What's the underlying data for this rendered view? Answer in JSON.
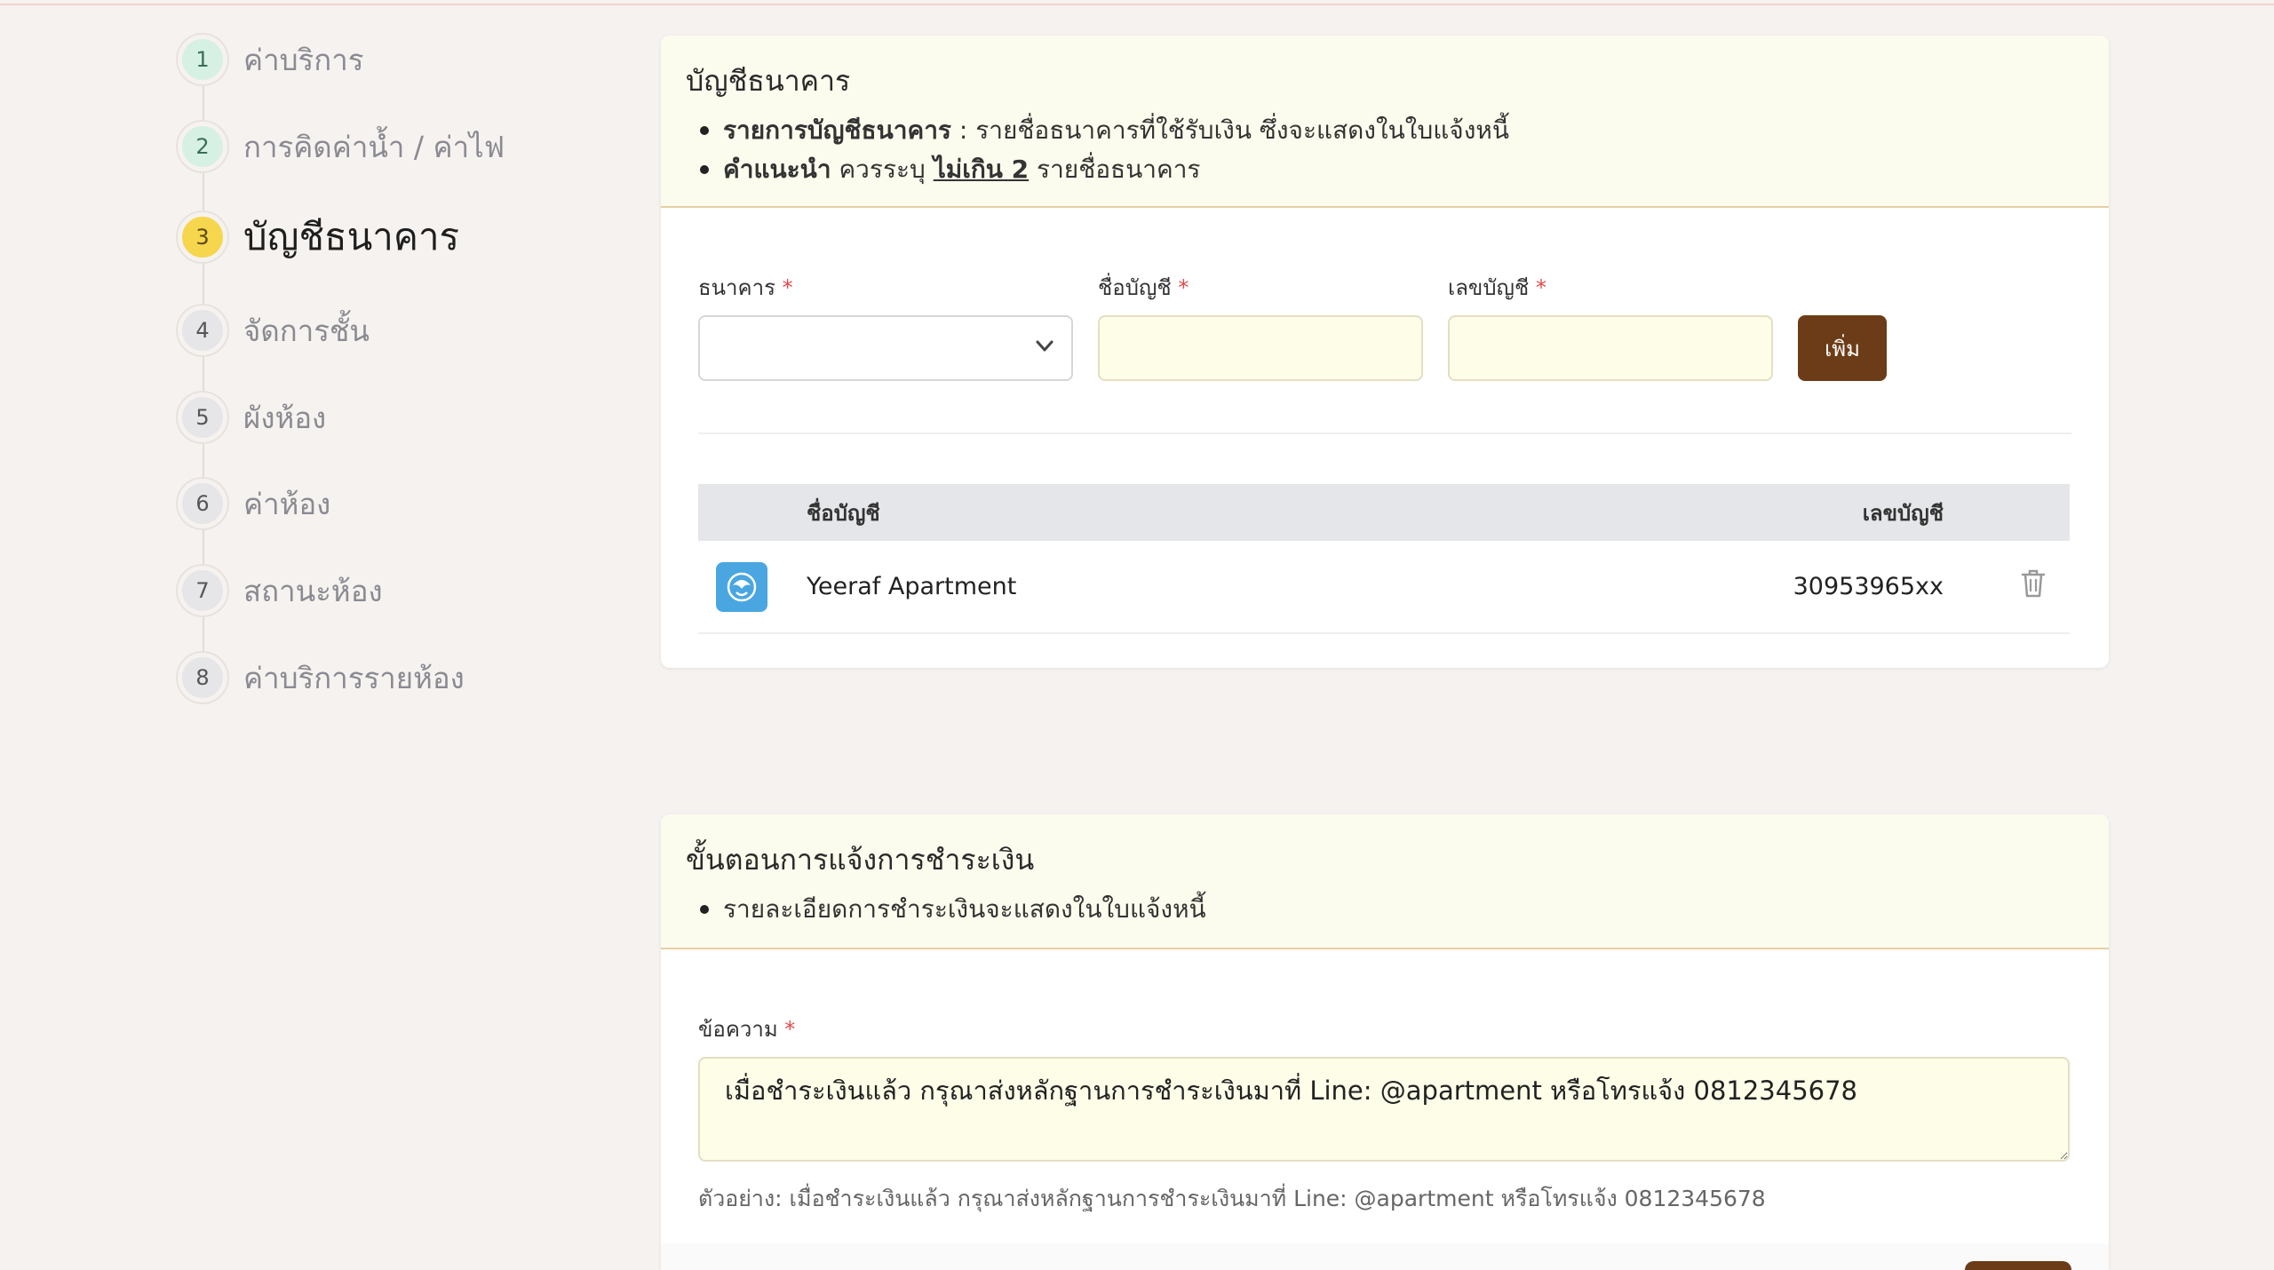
{
  "stepper": {
    "steps": [
      {
        "num": "1",
        "label": "ค่าบริการ",
        "state": "done"
      },
      {
        "num": "2",
        "label": "การคิดค่าน้ำ / ค่าไฟ",
        "state": "done"
      },
      {
        "num": "3",
        "label": "บัญชีธนาคาร",
        "state": "active"
      },
      {
        "num": "4",
        "label": "จัดการชั้น",
        "state": "todo"
      },
      {
        "num": "5",
        "label": "ผังห้อง",
        "state": "todo"
      },
      {
        "num": "6",
        "label": "ค่าห้อง",
        "state": "todo"
      },
      {
        "num": "7",
        "label": "สถานะห้อง",
        "state": "todo"
      },
      {
        "num": "8",
        "label": "ค่าบริการรายห้อง",
        "state": "todo"
      }
    ]
  },
  "bank": {
    "title": "บัญชีธนาคาร",
    "note1_bold": "รายการบัญชีธนาคาร",
    "note1_rest": " : รายชื่อธนาคารที่ใช้รับเงิน ซึ่งจะแสดงในใบแจ้งหนี้",
    "note2_bold": "คำแนะนำ",
    "note2_mid": " ควรระบุ ",
    "note2_underline": "ไม่เกิน 2",
    "note2_end": " รายชื่อธนาคาร",
    "form": {
      "bank_label": "ธนาคาร",
      "account_name_label": "ชื่อบัญชี",
      "account_number_label": "เลขบัญชี",
      "required_mark": "*",
      "add_label": "เพิ่ม",
      "bank_value": "",
      "account_name_value": "",
      "account_number_value": ""
    },
    "table": {
      "col_name": "ชื่อบัญชี",
      "col_number": "เลขบัญชี",
      "rows": [
        {
          "name": "Yeeraf Apartment",
          "number": "30953965xx",
          "logo": "kasikorn-logo-icon",
          "logo_color": "#4aa6e0"
        }
      ]
    }
  },
  "payment": {
    "title": "ขั้นตอนการแจ้งการชำระเงิน",
    "note1": "รายละเอียดการชำระเงินจะแสดงในใบแจ้งหนี้",
    "message_label": "ข้อความ",
    "required_mark": "*",
    "message_value": "เมื่อชำระเงินแล้ว กรุณาส่งหลักฐานการชำระเงินมาที่ Line: @apartment หรือโทรแจ้ง 0812345678",
    "hint": "ตัวอย่าง: เมื่อชำระเงินแล้ว กรุณาส่งหลักฐานการชำระเงินมาที่ Line: @apartment หรือโทรแจ้ง 0812345678"
  },
  "colors": {
    "accent_brown": "#6b3c17",
    "step_done": "#d6f1e3",
    "step_active": "#f6d64c",
    "header_bg": "#fcfcee"
  }
}
